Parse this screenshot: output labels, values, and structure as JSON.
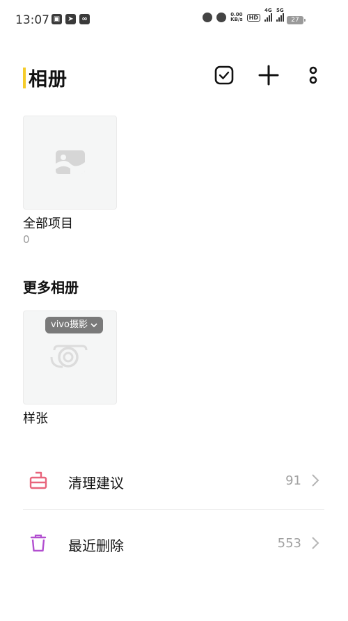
{
  "status_bar": {
    "time": "13:07",
    "net_speed_top": "0.00",
    "net_speed_unit": "KB/s",
    "hd_label": "HD",
    "net1": "4G",
    "net2": "5G",
    "battery": "27"
  },
  "header": {
    "title": "相册",
    "accent_color": "#f5cc2b",
    "actions": [
      "select-icon",
      "add-icon",
      "more-icon"
    ]
  },
  "albums": [
    {
      "name": "全部项目",
      "count": "0",
      "icon": "image-placeholder-icon"
    }
  ],
  "more_albums": {
    "title": "更多相册",
    "items": [
      {
        "name": "样张",
        "badge": "vivo摄影",
        "icon": "camera-logo-icon"
      }
    ]
  },
  "list": [
    {
      "label": "清理建议",
      "count": "91",
      "icon": "broom-icon",
      "icon_color": "#e8647c"
    },
    {
      "label": "最近删除",
      "count": "553",
      "icon": "trash-icon",
      "icon_color": "#b24fd0"
    }
  ]
}
